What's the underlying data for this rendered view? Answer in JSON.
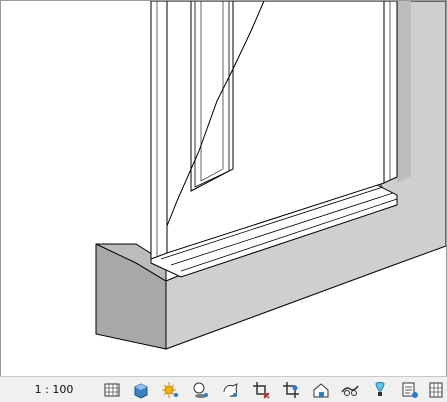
{
  "view": {
    "scale_label": "1 : 100"
  },
  "view_control_bar": {
    "icons": [
      "scale-menu",
      "detail-level-icon",
      "visual-style-icon",
      "sun-path-icon",
      "shadows-icon",
      "rendering-dialog-icon",
      "crop-view-icon",
      "show-crop-region-icon",
      "unlock-3d-view-icon",
      "temporary-hide-isolate-icon",
      "reveal-hidden-elements-icon",
      "temporary-view-properties-icon",
      "worksharing-display-icon"
    ]
  },
  "colors": {
    "wall_front": "#a8a8a8",
    "wall_right": "#cfcfcf",
    "wall_dark": "#8c8c8c",
    "edge": "#000000",
    "statusbar_bg": "#f0f0f0"
  }
}
